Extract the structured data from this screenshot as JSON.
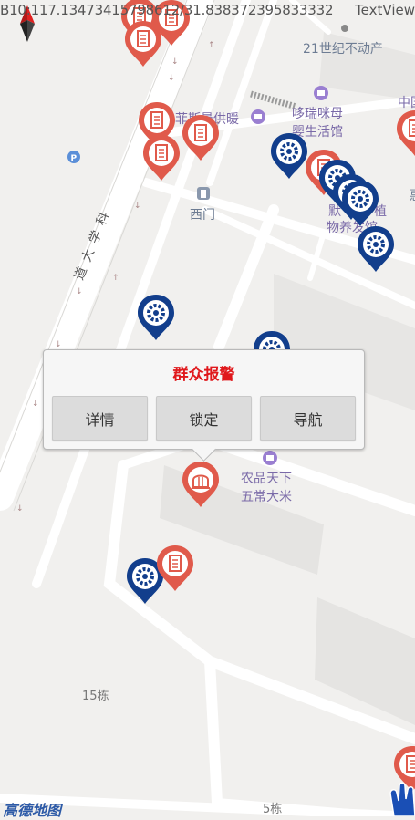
{
  "status": {
    "coords": "B10:117.13473415798612/31.838372395833332",
    "textview": "TextView"
  },
  "map_labels": {
    "century_realestate": "21世纪不动产",
    "duorui_line1": "哆瑞咪母",
    "duorui_line2": "婴生活馆",
    "feiyou_heating": "菲斯曼供暖",
    "west_gate": "西门",
    "science_avenue": [
      "科",
      "学",
      "大",
      "道"
    ],
    "nongpin_line1": "农品天下",
    "nongpin_line2": "五常大米",
    "moxun_line1": "默",
    "moxun_line2": "植",
    "moxun_line3": "物养发馆",
    "building_15": "15栋",
    "building_5": "5栋",
    "zhongguo": "中国",
    "xi": "惠"
  },
  "popup": {
    "title": "群众报警",
    "buttons": {
      "details": "详情",
      "lock": "锁定",
      "navigate": "导航"
    }
  },
  "brand": {
    "logo": "高德地图"
  },
  "colors": {
    "alarm_red": "#e0181c",
    "marker_red": "#e05a4b",
    "marker_blue": "#123e8c"
  }
}
